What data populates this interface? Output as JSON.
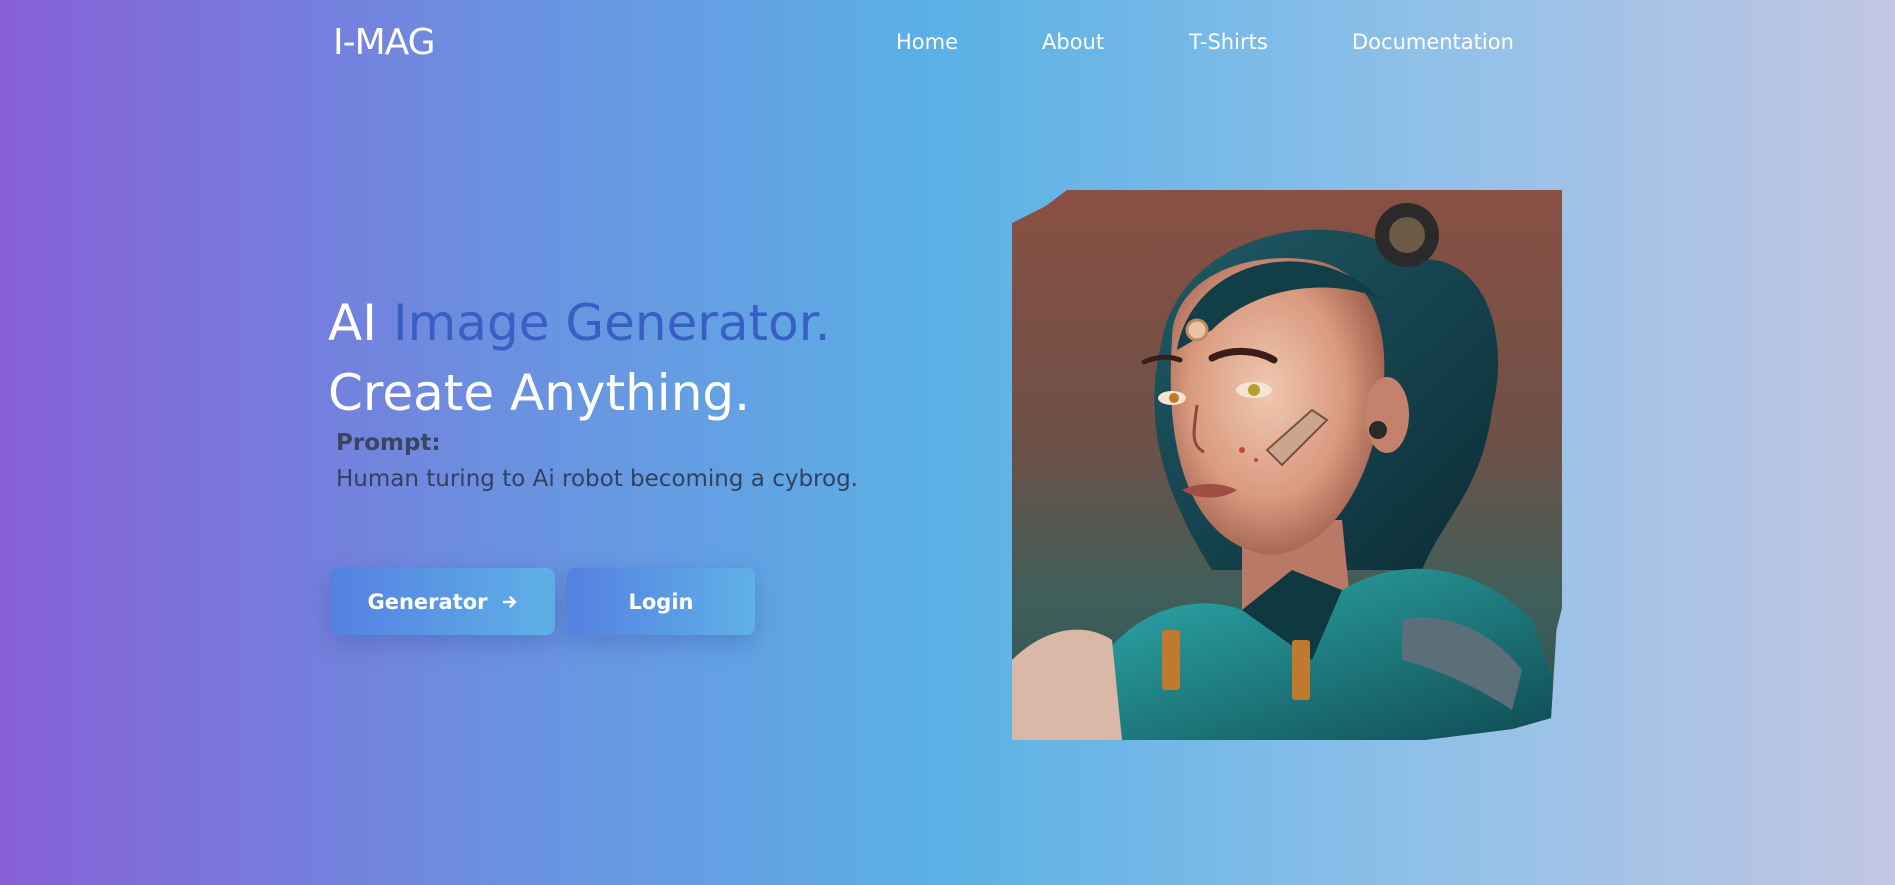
{
  "header": {
    "logo": "I-MAG",
    "nav": [
      "Home",
      "About",
      "T-Shirts",
      "Documentation"
    ]
  },
  "hero": {
    "headline_plain": "AI",
    "headline_accent": "Image Generator.",
    "headline_line2": "Create Anything.",
    "prompt_label": "Prompt:",
    "prompt_text": "Human turing to Ai robot becoming a cybrog."
  },
  "buttons": {
    "generator_label": "Generator",
    "generator_icon": "arrow-right-icon",
    "login_label": "Login"
  },
  "colors": {
    "accent": "#3a5fc4",
    "button_gradient_start": "#5580e2",
    "button_gradient_end": "#5fb1e6"
  },
  "image": {
    "subject": "generated-cyborg-portrait"
  }
}
